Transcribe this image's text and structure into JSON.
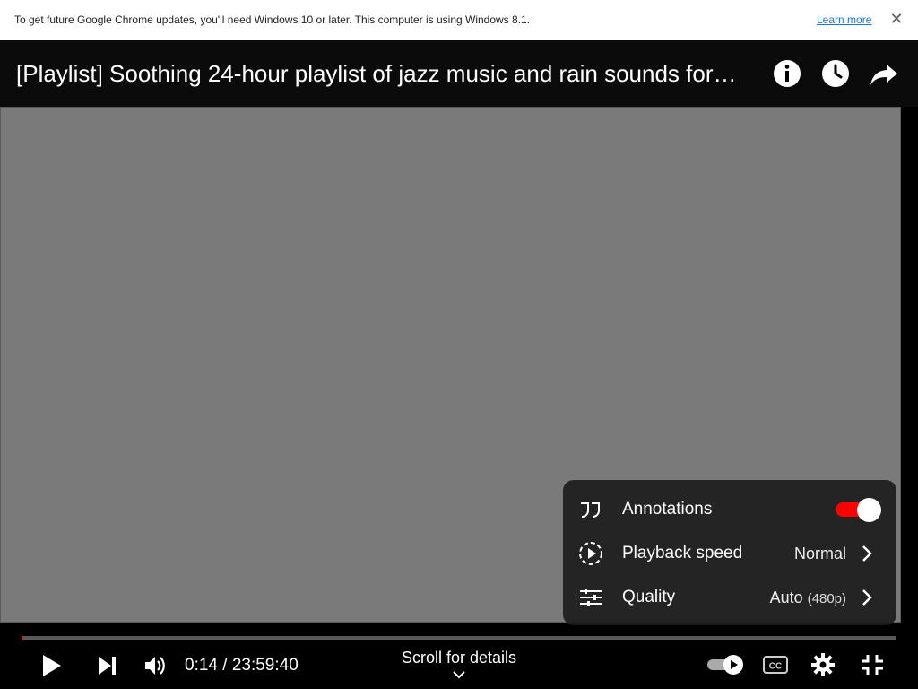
{
  "infobar": {
    "message": "To get future Google Chrome updates, you'll need Windows 10 or later. This computer is using Windows 8.1.",
    "learn_more": "Learn more",
    "close_icon": "close-icon"
  },
  "player": {
    "title": "[Playlist] Soothing 24-hour playlist of jazz music and rain sounds for…",
    "top_icons": [
      "info-icon",
      "watch-later-clock-icon",
      "share-arrow-icon"
    ],
    "settings_menu": {
      "annotations": {
        "label": "Annotations",
        "icon": "annotations-quote-icon",
        "enabled": true
      },
      "playback_speed": {
        "label": "Playback speed",
        "icon": "playback-speed-icon",
        "value": "Normal"
      },
      "quality": {
        "label": "Quality",
        "icon": "quality-sliders-icon",
        "value": "Auto",
        "value_detail": "(480p)"
      }
    },
    "progress_fraction": 0.0002,
    "controls": {
      "current_time": "0:14",
      "duration": "23:59:40",
      "time_display": "0:14 / 23:59:40",
      "scroll_for_details": "Scroll for details",
      "autoplay_on": true
    },
    "colors": {
      "accent": "#ff0000",
      "menu_bg": "#1c1c1c"
    }
  }
}
